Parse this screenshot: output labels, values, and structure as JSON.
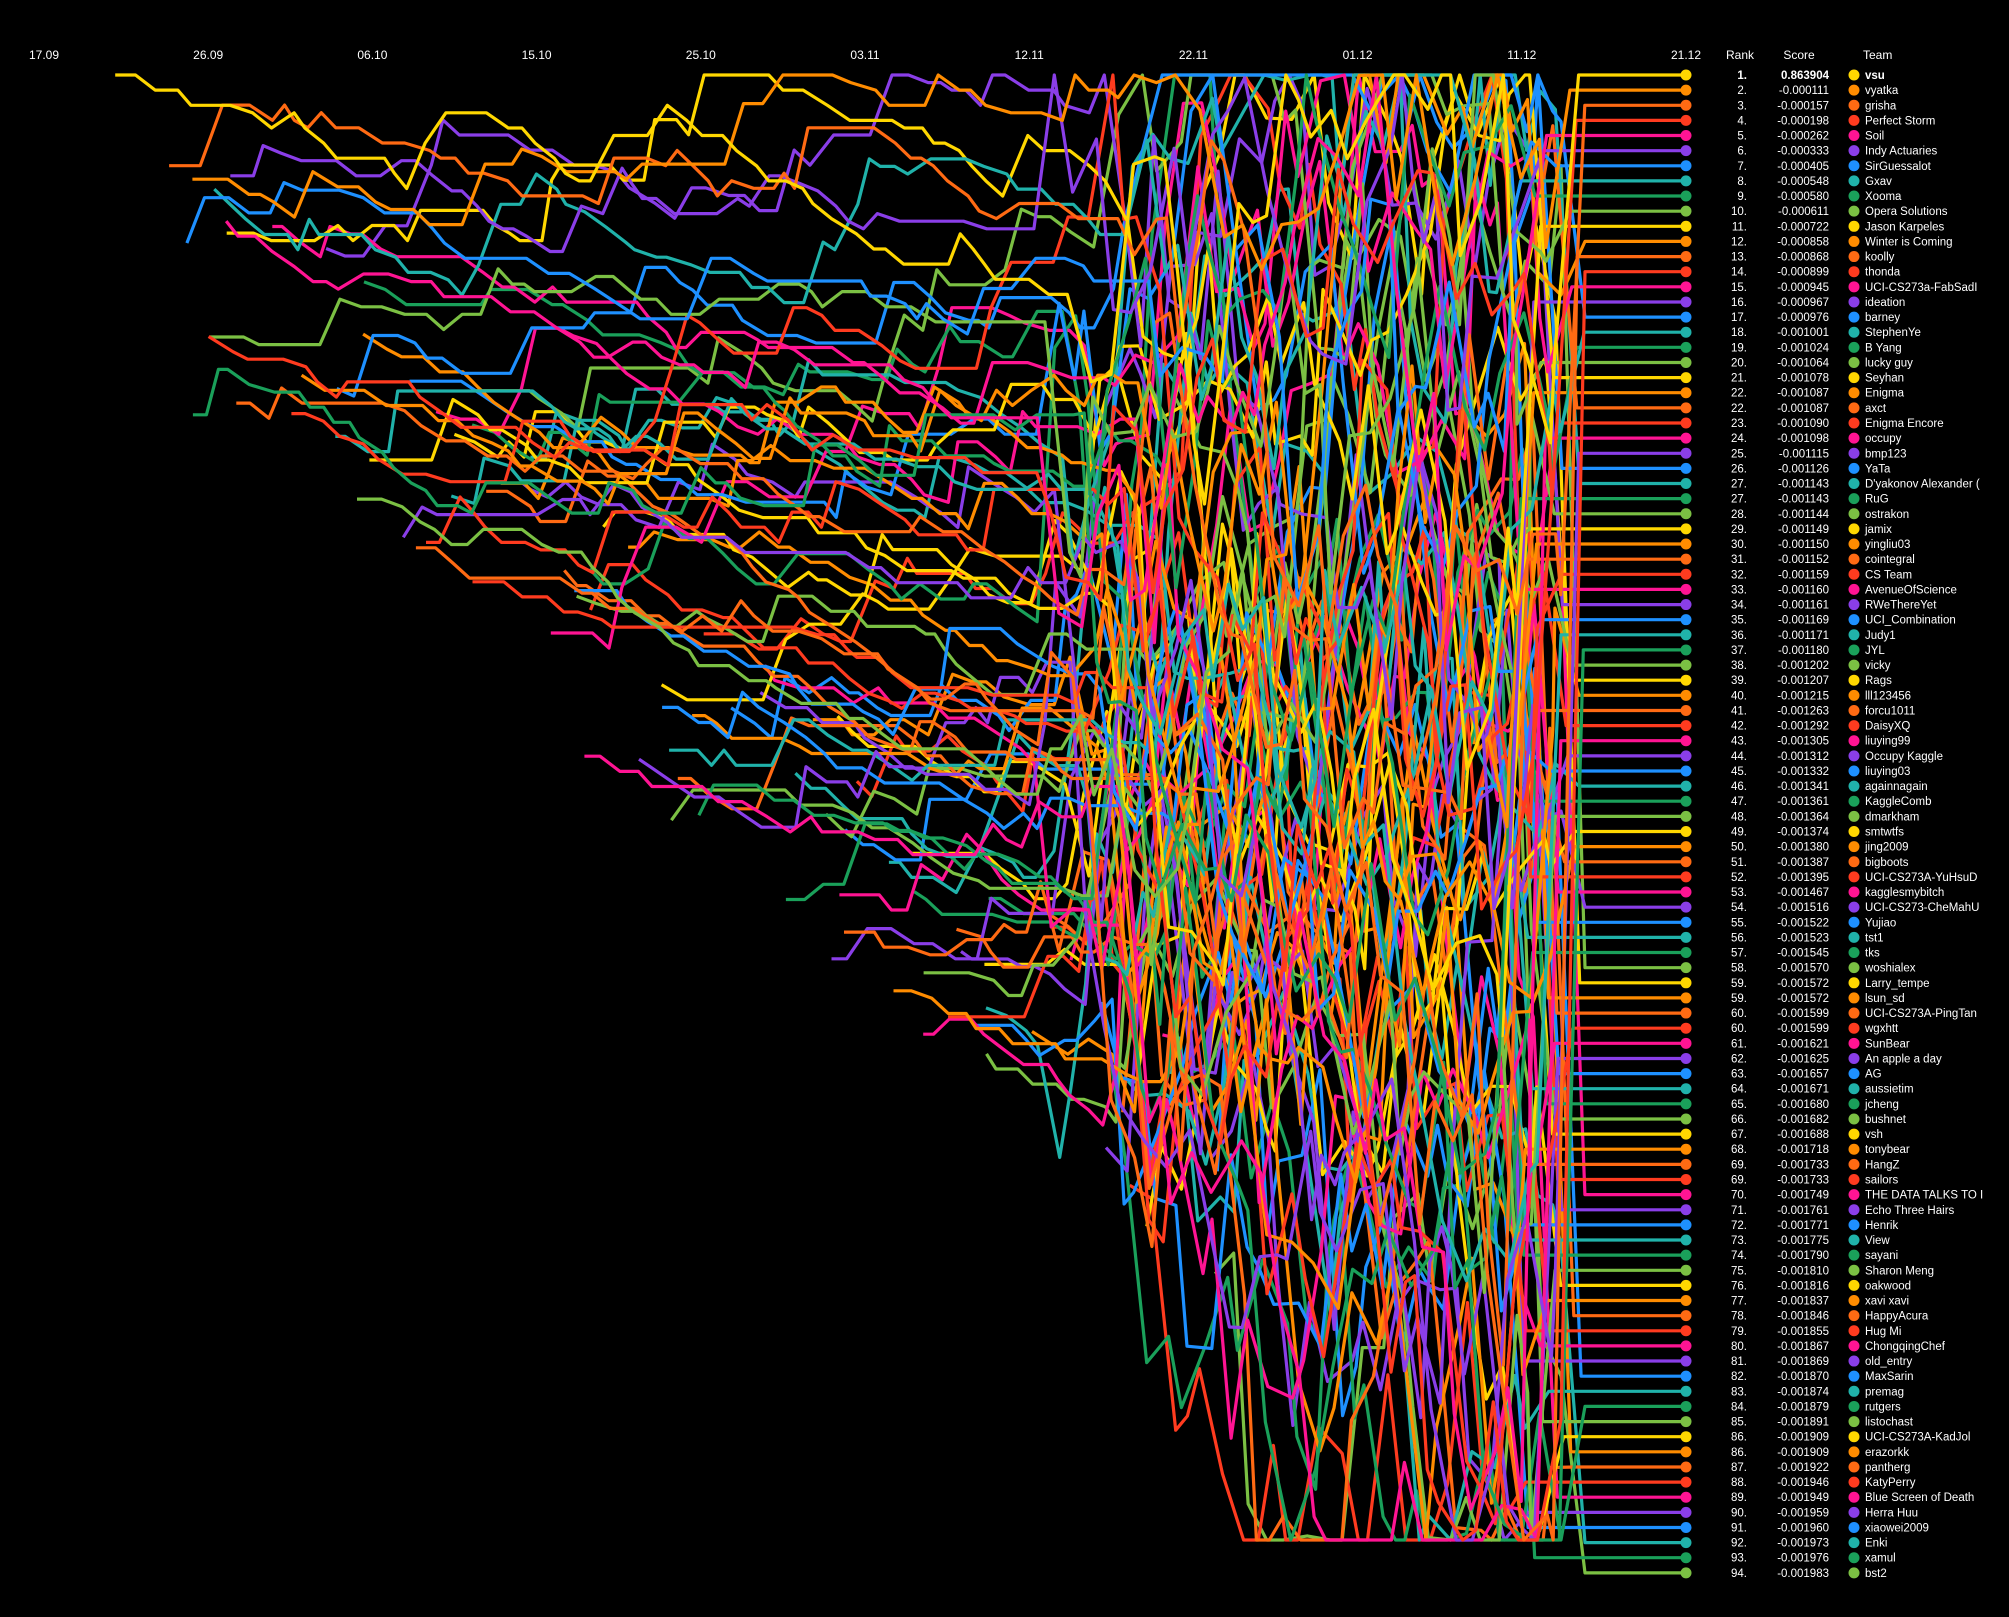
{
  "palette": [
    "#ffd700",
    "#ff8c00",
    "#ff6a13",
    "#ff3b1f",
    "#ff1493",
    "#8a3ee8",
    "#1e90ff",
    "#20b2aa",
    "#1aa05a",
    "#7bc043"
  ],
  "background": "#000000",
  "chart_data": {
    "type": "line",
    "title": "",
    "xlabel": "",
    "ylabel": "",
    "x_ticks": [
      "17.09",
      "26.09",
      "06.10",
      "15.10",
      "25.10",
      "03.11",
      "12.11",
      "22.11",
      "01.12",
      "11.12",
      "21.12"
    ],
    "y_axis": "rank (1 at top)",
    "legend_placement": "right",
    "columns": {
      "rank": "Rank",
      "score": "Score",
      "team": "Team"
    },
    "series": [
      {
        "rank": "1.",
        "score": "0.863904",
        "name": "vsu"
      },
      {
        "rank": "2.",
        "score": "-0.000111",
        "name": "vyatka"
      },
      {
        "rank": "3.",
        "score": "-0.000157",
        "name": "grisha"
      },
      {
        "rank": "4.",
        "score": "-0.000198",
        "name": "Perfect Storm"
      },
      {
        "rank": "5.",
        "score": "-0.000262",
        "name": "Soil"
      },
      {
        "rank": "6.",
        "score": "-0.000333",
        "name": "Indy Actuaries"
      },
      {
        "rank": "7.",
        "score": "-0.000405",
        "name": "SirGuessalot"
      },
      {
        "rank": "8.",
        "score": "-0.000548",
        "name": "Gxav"
      },
      {
        "rank": "9.",
        "score": "-0.000580",
        "name": "Xooma"
      },
      {
        "rank": "10.",
        "score": "-0.000611",
        "name": "Opera Solutions"
      },
      {
        "rank": "11.",
        "score": "-0.000722",
        "name": "Jason Karpeles"
      },
      {
        "rank": "12.",
        "score": "-0.000858",
        "name": "Winter is Coming"
      },
      {
        "rank": "13.",
        "score": "-0.000868",
        "name": "koolly"
      },
      {
        "rank": "14.",
        "score": "-0.000899",
        "name": "thonda"
      },
      {
        "rank": "15.",
        "score": "-0.000945",
        "name": "UCI-CS273a-FabSadI"
      },
      {
        "rank": "16.",
        "score": "-0.000967",
        "name": "ideation"
      },
      {
        "rank": "17.",
        "score": "-0.000976",
        "name": "barney"
      },
      {
        "rank": "18.",
        "score": "-0.001001",
        "name": "StephenYe"
      },
      {
        "rank": "19.",
        "score": "-0.001024",
        "name": "B Yang"
      },
      {
        "rank": "20.",
        "score": "-0.001064",
        "name": "lucky guy"
      },
      {
        "rank": "21.",
        "score": "-0.001078",
        "name": "Seyhan"
      },
      {
        "rank": "22.",
        "score": "-0.001087",
        "name": "Enigma"
      },
      {
        "rank": "22.",
        "score": "-0.001087",
        "name": "axct"
      },
      {
        "rank": "23.",
        "score": "-0.001090",
        "name": "Enigma Encore"
      },
      {
        "rank": "24.",
        "score": "-0.001098",
        "name": "occupy"
      },
      {
        "rank": "25.",
        "score": "-0.001115",
        "name": "bmp123"
      },
      {
        "rank": "26.",
        "score": "-0.001126",
        "name": "YaTa"
      },
      {
        "rank": "27.",
        "score": "-0.001143",
        "name": "D'yakonov Alexander ("
      },
      {
        "rank": "27.",
        "score": "-0.001143",
        "name": "RuG"
      },
      {
        "rank": "28.",
        "score": "-0.001144",
        "name": "ostrakon"
      },
      {
        "rank": "29.",
        "score": "-0.001149",
        "name": "jamix"
      },
      {
        "rank": "30.",
        "score": "-0.001150",
        "name": "yingliu03"
      },
      {
        "rank": "31.",
        "score": "-0.001152",
        "name": "cointegral"
      },
      {
        "rank": "32.",
        "score": "-0.001159",
        "name": "CS Team"
      },
      {
        "rank": "33.",
        "score": "-0.001160",
        "name": "AvenueOfScience"
      },
      {
        "rank": "34.",
        "score": "-0.001161",
        "name": "RWeThereYet"
      },
      {
        "rank": "35.",
        "score": "-0.001169",
        "name": "UCI_Combination"
      },
      {
        "rank": "36.",
        "score": "-0.001171",
        "name": "Judy1"
      },
      {
        "rank": "37.",
        "score": "-0.001180",
        "name": "JYL"
      },
      {
        "rank": "38.",
        "score": "-0.001202",
        "name": "vicky"
      },
      {
        "rank": "39.",
        "score": "-0.001207",
        "name": "Rags"
      },
      {
        "rank": "40.",
        "score": "-0.001215",
        "name": "lll123456"
      },
      {
        "rank": "41.",
        "score": "-0.001263",
        "name": "forcu1011"
      },
      {
        "rank": "42.",
        "score": "-0.001292",
        "name": "DaisyXQ"
      },
      {
        "rank": "43.",
        "score": "-0.001305",
        "name": "liuying99"
      },
      {
        "rank": "44.",
        "score": "-0.001312",
        "name": "Occupy Kaggle"
      },
      {
        "rank": "45.",
        "score": "-0.001332",
        "name": "liuying03"
      },
      {
        "rank": "46.",
        "score": "-0.001341",
        "name": "againnagain"
      },
      {
        "rank": "47.",
        "score": "-0.001361",
        "name": "KaggleComb"
      },
      {
        "rank": "48.",
        "score": "-0.001364",
        "name": "dmarkham"
      },
      {
        "rank": "49.",
        "score": "-0.001374",
        "name": "smtwtfs"
      },
      {
        "rank": "50.",
        "score": "-0.001380",
        "name": "jing2009"
      },
      {
        "rank": "51.",
        "score": "-0.001387",
        "name": "bigboots"
      },
      {
        "rank": "52.",
        "score": "-0.001395",
        "name": "UCI-CS273A-YuHsuD"
      },
      {
        "rank": "53.",
        "score": "-0.001467",
        "name": "kagglesmybitch"
      },
      {
        "rank": "54.",
        "score": "-0.001516",
        "name": "UCI-CS273-CheMahU"
      },
      {
        "rank": "55.",
        "score": "-0.001522",
        "name": "Yujiao"
      },
      {
        "rank": "56.",
        "score": "-0.001523",
        "name": "tst1"
      },
      {
        "rank": "57.",
        "score": "-0.001545",
        "name": "tks"
      },
      {
        "rank": "58.",
        "score": "-0.001570",
        "name": "woshialex"
      },
      {
        "rank": "59.",
        "score": "-0.001572",
        "name": "Larry_tempe"
      },
      {
        "rank": "59.",
        "score": "-0.001572",
        "name": "lsun_sd"
      },
      {
        "rank": "60.",
        "score": "-0.001599",
        "name": "UCI-CS273A-PingTan"
      },
      {
        "rank": "60.",
        "score": "-0.001599",
        "name": "wgxhtt"
      },
      {
        "rank": "61.",
        "score": "-0.001621",
        "name": "SunBear"
      },
      {
        "rank": "62.",
        "score": "-0.001625",
        "name": "An apple a day"
      },
      {
        "rank": "63.",
        "score": "-0.001657",
        "name": "AG"
      },
      {
        "rank": "64.",
        "score": "-0.001671",
        "name": "aussietim"
      },
      {
        "rank": "65.",
        "score": "-0.001680",
        "name": "jcheng"
      },
      {
        "rank": "66.",
        "score": "-0.001682",
        "name": "bushnet"
      },
      {
        "rank": "67.",
        "score": "-0.001688",
        "name": "vsh"
      },
      {
        "rank": "68.",
        "score": "-0.001718",
        "name": "tonybear"
      },
      {
        "rank": "69.",
        "score": "-0.001733",
        "name": "HangZ"
      },
      {
        "rank": "69.",
        "score": "-0.001733",
        "name": "sailors"
      },
      {
        "rank": "70.",
        "score": "-0.001749",
        "name": "THE DATA TALKS TO I"
      },
      {
        "rank": "71.",
        "score": "-0.001761",
        "name": "Echo Three Hairs"
      },
      {
        "rank": "72.",
        "score": "-0.001771",
        "name": "Henrik"
      },
      {
        "rank": "73.",
        "score": "-0.001775",
        "name": "View"
      },
      {
        "rank": "74.",
        "score": "-0.001790",
        "name": "sayani"
      },
      {
        "rank": "75.",
        "score": "-0.001810",
        "name": "Sharon Meng"
      },
      {
        "rank": "76.",
        "score": "-0.001816",
        "name": "oakwood"
      },
      {
        "rank": "77.",
        "score": "-0.001837",
        "name": "xavi xavi"
      },
      {
        "rank": "78.",
        "score": "-0.001846",
        "name": "HappyAcura"
      },
      {
        "rank": "79.",
        "score": "-0.001855",
        "name": "Hug Mi"
      },
      {
        "rank": "80.",
        "score": "-0.001867",
        "name": "ChongqingChef"
      },
      {
        "rank": "81.",
        "score": "-0.001869",
        "name": "old_entry"
      },
      {
        "rank": "82.",
        "score": "-0.001870",
        "name": "MaxSarin"
      },
      {
        "rank": "83.",
        "score": "-0.001874",
        "name": "premag"
      },
      {
        "rank": "84.",
        "score": "-0.001879",
        "name": "rutgers"
      },
      {
        "rank": "85.",
        "score": "-0.001891",
        "name": "listochast"
      },
      {
        "rank": "86.",
        "score": "-0.001909",
        "name": "UCI-CS273A-KadJol"
      },
      {
        "rank": "86.",
        "score": "-0.001909",
        "name": "erazorkk"
      },
      {
        "rank": "87.",
        "score": "-0.001922",
        "name": "pantherg"
      },
      {
        "rank": "88.",
        "score": "-0.001946",
        "name": "KatyPerry"
      },
      {
        "rank": "89.",
        "score": "-0.001949",
        "name": "Blue Screen of Death"
      },
      {
        "rank": "90.",
        "score": "-0.001959",
        "name": "Herra Huu"
      },
      {
        "rank": "91.",
        "score": "-0.001960",
        "name": "xiaowei2009"
      },
      {
        "rank": "92.",
        "score": "-0.001973",
        "name": "Enki"
      },
      {
        "rank": "93.",
        "score": "-0.001976",
        "name": "xamul"
      },
      {
        "rank": "94.",
        "score": "-0.001983",
        "name": "bst2"
      }
    ]
  }
}
